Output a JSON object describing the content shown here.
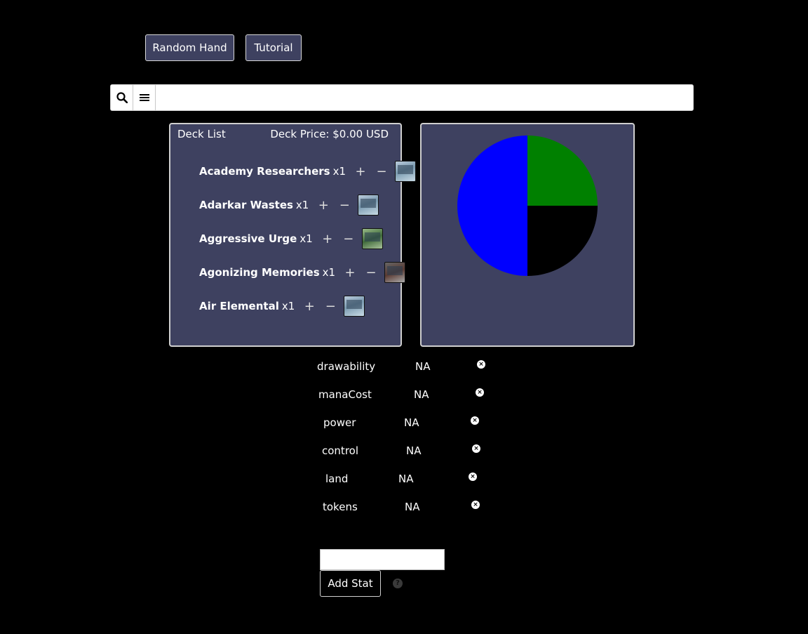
{
  "toolbar": {
    "random_hand_label": "Random Hand",
    "tutorial_label": "Tutorial"
  },
  "search": {
    "search_icon": "search-icon",
    "menu_icon": "menu-icon",
    "value": ""
  },
  "deck": {
    "title": "Deck List",
    "price": "Deck Price: $0.00 USD",
    "cards": [
      {
        "name": "Academy Researchers",
        "qty": "x1",
        "plus": "+",
        "minus": "−"
      },
      {
        "name": "Adarkar Wastes",
        "qty": "x1",
        "plus": "+",
        "minus": "−"
      },
      {
        "name": "Aggressive Urge",
        "qty": "x1",
        "plus": "+",
        "minus": "−"
      },
      {
        "name": "Agonizing Memories",
        "qty": "x1",
        "plus": "+",
        "minus": "−"
      },
      {
        "name": "Air Elemental",
        "qty": "x1",
        "plus": "+",
        "minus": "−"
      }
    ]
  },
  "chart_data": {
    "type": "pie",
    "slices": [
      {
        "value": 25,
        "color": "#008000"
      },
      {
        "value": 25,
        "color": "#000000"
      },
      {
        "value": 50,
        "color": "#0000ff"
      }
    ]
  },
  "stats": [
    {
      "name": "drawability",
      "value": "NA"
    },
    {
      "name": "manaCost",
      "value": "NA"
    },
    {
      "name": "power",
      "value": "NA"
    },
    {
      "name": "control",
      "value": "NA"
    },
    {
      "name": "land",
      "value": "NA"
    },
    {
      "name": "tokens",
      "value": "NA"
    }
  ],
  "add_stat": {
    "input_value": "",
    "button_label": "Add Stat",
    "help_icon": "help-icon"
  }
}
